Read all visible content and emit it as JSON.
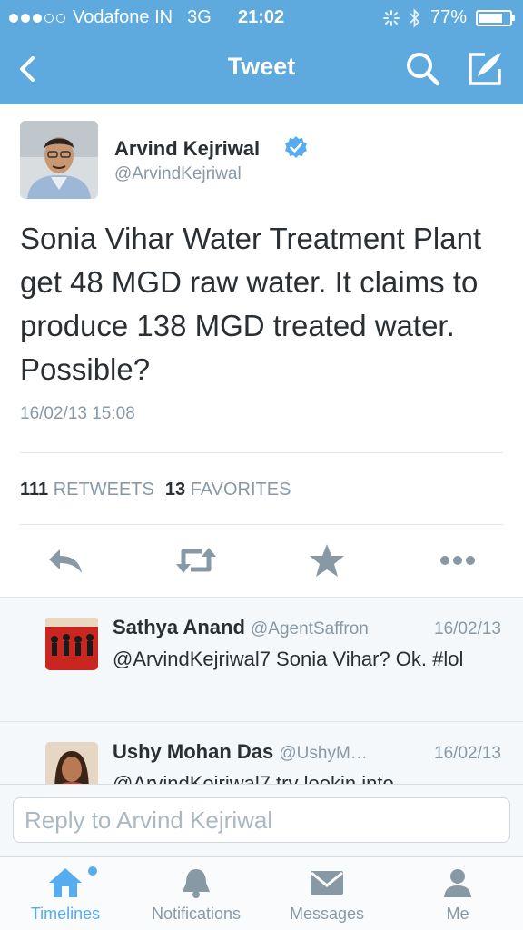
{
  "status_bar": {
    "carrier": "Vodafone IN",
    "network": "3G",
    "time": "21:02",
    "battery": "77%",
    "battery_level": 0.77
  },
  "nav": {
    "title": "Tweet",
    "back_icon": "chevron-left-icon",
    "search_icon": "search-icon",
    "compose_icon": "compose-icon"
  },
  "tweet": {
    "author_name": "Arvind Kejriwal",
    "author_handle": "@ArvindKejriwal",
    "verified": true,
    "text": "Sonia Vihar Water Treatment Plant get 48 MGD raw water. It claims to produce 138 MGD treated water. Possible?",
    "timestamp": "16/02/13 15:08",
    "retweets_count": "111",
    "retweets_label": "RETWEETS",
    "favorites_count": "13",
    "favorites_label": "FAVORITES"
  },
  "replies": [
    {
      "name": "Sathya Anand",
      "handle": "@AgentSaffron",
      "date": "16/02/13",
      "text": "@ArvindKejriwal7 Sonia Vihar? Ok. #lol"
    },
    {
      "name": "Ushy Mohan Das",
      "handle": "@UshyM…",
      "date": "16/02/13",
      "text": "@ArvindKejriwal7 try lookin into"
    }
  ],
  "reply_box": {
    "placeholder": "Reply to Arvind Kejriwal"
  },
  "tabs": [
    {
      "label": "Timelines",
      "icon": "home-icon",
      "active": true
    },
    {
      "label": "Notifications",
      "icon": "bell-icon",
      "active": false
    },
    {
      "label": "Messages",
      "icon": "envelope-icon",
      "active": false
    },
    {
      "label": "Me",
      "icon": "person-icon",
      "active": false
    }
  ],
  "colors": {
    "brand": "#5ea9dd",
    "accent": "#55acee",
    "muted": "#8899a6",
    "text": "#292f33",
    "verified": "#55acee"
  }
}
